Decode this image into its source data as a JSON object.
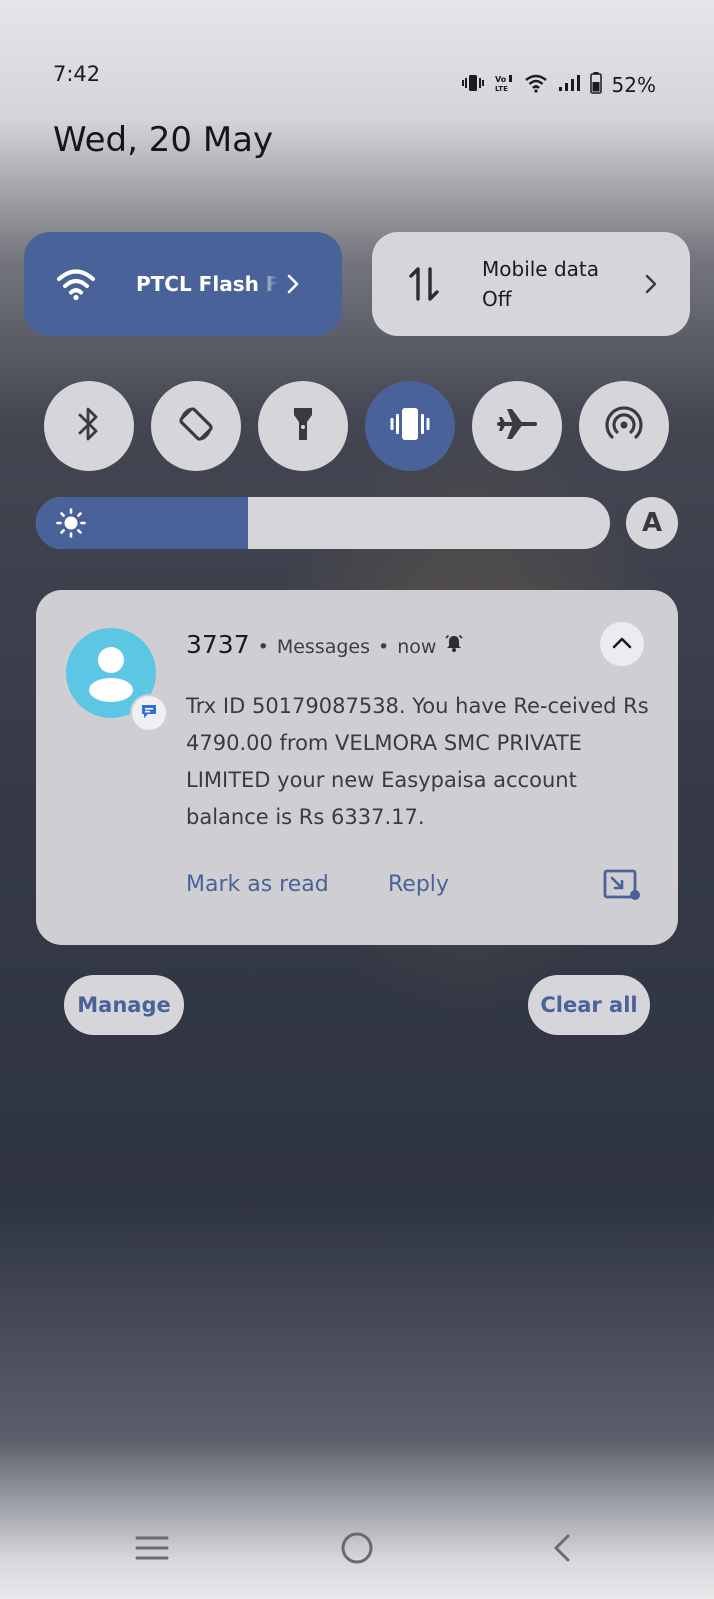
{
  "status_bar": {
    "time": "7:42",
    "battery_percent": "52%",
    "icons": [
      "vibrate-icon",
      "volte-icon",
      "wifi-icon",
      "signal-icon",
      "battery-icon"
    ]
  },
  "date": "Wed, 20 May",
  "quick_tiles": {
    "wifi": {
      "label": "PTCL Flash F",
      "active": true
    },
    "mobile_data": {
      "label": "Mobile data",
      "state": "Off",
      "active": false
    }
  },
  "quick_settings": [
    {
      "name": "bluetooth",
      "active": false
    },
    {
      "name": "auto-rotate",
      "active": false
    },
    {
      "name": "flashlight",
      "active": false
    },
    {
      "name": "vibrate",
      "active": true
    },
    {
      "name": "airplane-mode",
      "active": false
    },
    {
      "name": "hotspot",
      "active": false
    }
  ],
  "brightness": {
    "level": 0.37,
    "auto_label": "A"
  },
  "notification": {
    "sender": "3737",
    "app": "Messages",
    "time": "now",
    "body": "Trx ID 50179087538. You have Re-ceived Rs 4790.00 from VELMORA SMC PRIVATE LIMITED your new Easypaisa account balance is Rs 6337.17.",
    "actions": {
      "mark_read": "Mark as read",
      "reply": "Reply"
    }
  },
  "buttons": {
    "manage": "Manage",
    "clear_all": "Clear all"
  },
  "colors": {
    "accent": "#4a629a",
    "tile": "#d6d6da",
    "card": "#cfcfd3",
    "avatar": "#5cc6e4"
  }
}
